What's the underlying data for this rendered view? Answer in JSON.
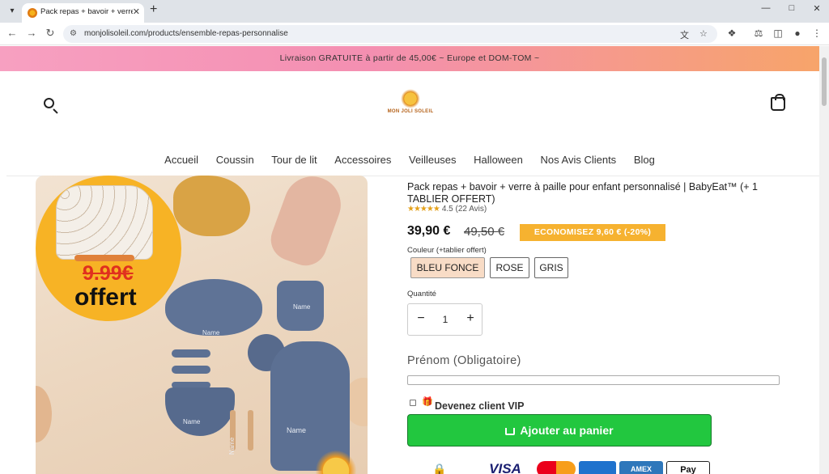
{
  "browser": {
    "tab_title": "Pack repas + bavoir + verre à paille",
    "url": "monjolisoleil.com/products/ensemble-repas-personnalise"
  },
  "announcement": "Livraison GRATUITE à partir de 45,00€ ~ Europe et DOM-TOM ~",
  "logo": {
    "text": "MON JOLI SOLEIL"
  },
  "nav": [
    "Accueil",
    "Coussin",
    "Tour de lit",
    "Accessoires",
    "Veilleuses",
    "Halloween",
    "Nos Avis Clients",
    "Blog"
  ],
  "image": {
    "badge_price": "9.99€",
    "badge_text": "offert",
    "name_labels": [
      "Name",
      "Name",
      "Name",
      "Name",
      "Name"
    ]
  },
  "product": {
    "title": "Pack repas + bavoir + verre à paille pour enfant personnalisé | BabyEat™ (+ 1 TABLIER OFFERT)",
    "rating_stars": "★★★★★",
    "rating": "4.5 (22 Avis)",
    "price": "39,90 €",
    "old_price": "49,50 €",
    "savings": "ECONOMISEZ 9,60 € (-20%)",
    "color_label": "Couleur (+tablier offert)",
    "colors": [
      "BLEU FONCE",
      "ROSE",
      "GRIS"
    ],
    "selected_color": "BLEU FONCE",
    "quantity_label": "Quantité",
    "quantity": "1",
    "firstname_label": "Prénom (Obligatoire)",
    "firstname_value": "",
    "vip_label": "Devenez client VIP",
    "add_to_cart": "Ajouter au panier"
  },
  "payments": [
    "VISA",
    "AMEX",
    "Pay"
  ],
  "colors": {
    "announcement_start": "#f7a0c1",
    "announcement_end": "#f7a46a",
    "savings_badge": "#f6b230",
    "add_to_cart": "#22c73f",
    "selected_variant": "#f8dcc6"
  }
}
